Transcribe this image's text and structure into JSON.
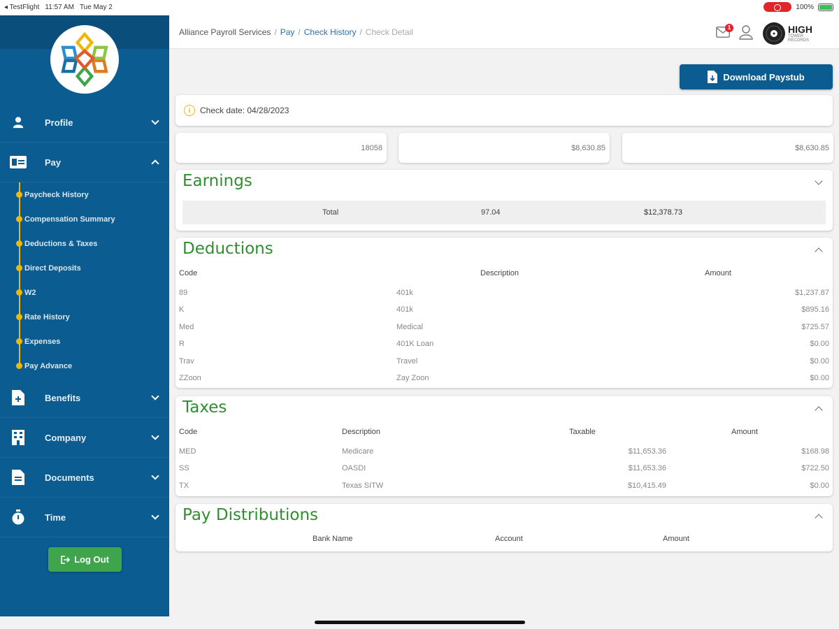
{
  "status_bar": {
    "app": "◂ TestFlight",
    "time": "11:57 AM",
    "date": "Tue May 2",
    "battery": "100%"
  },
  "sidebar": {
    "items": [
      {
        "label": "Profile",
        "icon": "person-icon"
      },
      {
        "label": "Pay",
        "icon": "pay-card-icon"
      },
      {
        "label": "Benefits",
        "icon": "document-plus-icon"
      },
      {
        "label": "Company",
        "icon": "building-icon"
      },
      {
        "label": "Documents",
        "icon": "document-icon"
      },
      {
        "label": "Time",
        "icon": "stopwatch-icon"
      }
    ],
    "pay_sub_items": [
      "Paycheck History",
      "Compensation Summary",
      "Deductions & Taxes",
      "Direct Deposits",
      "W2",
      "Rate History",
      "Expenses",
      "Pay Advance"
    ],
    "logout_label": "Log Out"
  },
  "header": {
    "breadcrumb": [
      "Alliance Payroll Services",
      "Pay",
      "Check History",
      "Check Detail"
    ],
    "notification_count": "1",
    "brand_big": "HIGH",
    "brand_small1": "TOWER",
    "brand_small2": "RECORDS"
  },
  "main": {
    "download_label": "Download Paystub",
    "check_date": "Check date: 04/28/2023",
    "stats": [
      "18058",
      "$8,630.85",
      "$8,630.85"
    ],
    "earnings": {
      "title": "Earnings",
      "total_label": "Total",
      "total_hours": "97.04",
      "total_amount": "$12,378.73"
    },
    "deductions": {
      "title": "Deductions",
      "headers": [
        "Code",
        "Description",
        "Amount"
      ],
      "rows": [
        [
          "89",
          "401k",
          "$1,237.87"
        ],
        [
          "K",
          "401k",
          "$895.16"
        ],
        [
          "Med",
          "Medical",
          "$725.57"
        ],
        [
          "R",
          "401K Loan",
          "$0.00"
        ],
        [
          "Trav",
          "Travel",
          "$0.00"
        ],
        [
          "ZZoon",
          "Zay Zoon",
          "$0.00"
        ]
      ]
    },
    "taxes": {
      "title": "Taxes",
      "headers": [
        "Code",
        "Description",
        "Taxable",
        "Amount"
      ],
      "rows": [
        [
          "MED",
          "Medicare",
          "$11,653.36",
          "$168.98"
        ],
        [
          "SS",
          "OASDI",
          "$11,653.36",
          "$722.50"
        ],
        [
          "TX",
          "Texas SITW",
          "$10,415.49",
          "$0.00"
        ]
      ]
    },
    "pay_distributions": {
      "title": "Pay Distributions",
      "headers": [
        "Bank Name",
        "Account",
        "Amount"
      ]
    }
  },
  "colors": {
    "sidebar": "#0b5d91",
    "accent_green": "#2f8f2f",
    "bullet": "#f2b705",
    "logout": "#3fa54d"
  }
}
